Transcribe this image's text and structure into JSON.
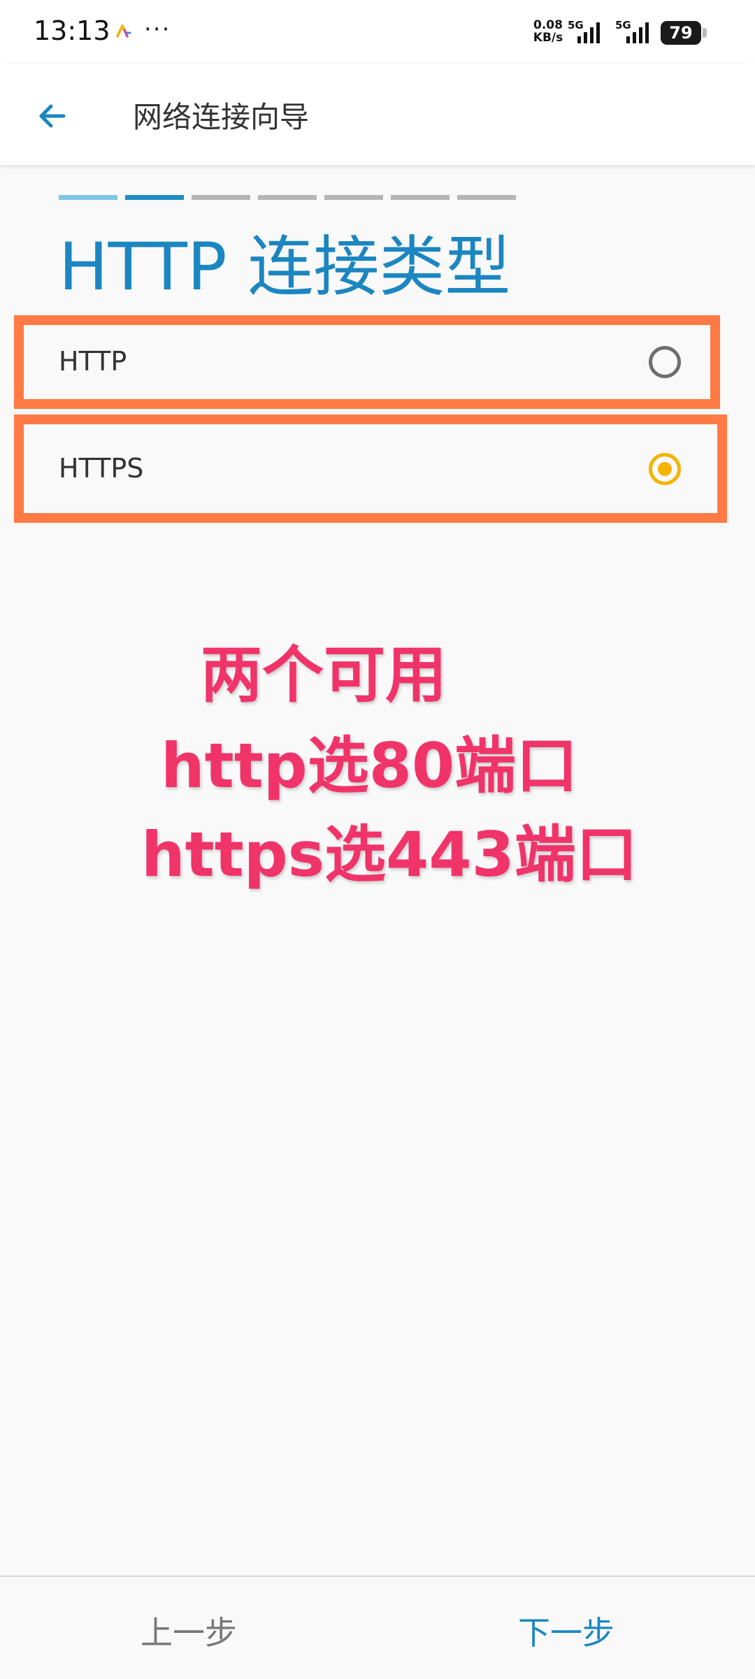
{
  "status_bar": {
    "time": "13:13",
    "more": "···",
    "net_speed_value": "0.08",
    "net_speed_unit": "KB/s",
    "sim1_network": "5G",
    "sim2_network": "5G",
    "battery": "79"
  },
  "app_bar": {
    "title": "网络连接向导",
    "back_icon": "arrow-left-icon"
  },
  "wizard": {
    "steps_total": 7,
    "current_step": 2,
    "heading": "HTTP 连接类型"
  },
  "options": [
    {
      "label": "HTTP",
      "selected": false
    },
    {
      "label": "HTTPS",
      "selected": true
    }
  ],
  "annotation": {
    "line1": "两个可用",
    "line2": "http选80端口",
    "line3": "https选443端口"
  },
  "navigation": {
    "prev_label": "上一步",
    "next_label": "下一步"
  },
  "colors": {
    "accent": "#1b86c0",
    "radio_selected": "#f4b400",
    "highlight_frame": "#ff7a45",
    "annotation_text": "#f0346a"
  }
}
